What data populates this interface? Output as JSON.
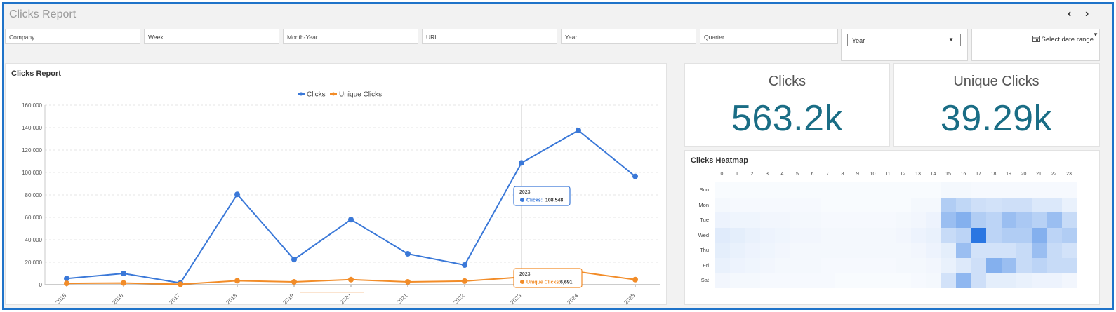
{
  "app": {
    "title": "Clicks Report",
    "prev_label": "‹",
    "next_label": "›"
  },
  "filters": {
    "company": "Company",
    "week": "Week",
    "month_year": "Month-Year",
    "url": "URL",
    "year": "Year",
    "quarter": "Quarter",
    "year_select": "Year",
    "date_range": "Select date range"
  },
  "chart_panel": {
    "title": "Clicks Report"
  },
  "kpis": {
    "clicks": {
      "label": "Clicks",
      "value": "563.2k"
    },
    "unique_clicks": {
      "label": "Unique Clicks",
      "value": "39.29k"
    }
  },
  "chart_data": {
    "type": "line",
    "title": "Clicks Report",
    "x": [
      "2015",
      "2016",
      "2017",
      "2018",
      "2019",
      "2020",
      "2021",
      "2022",
      "2023",
      "2024",
      "2025"
    ],
    "ylim": [
      0,
      160000
    ],
    "yticks": [
      0,
      20000,
      40000,
      60000,
      80000,
      100000,
      120000,
      140000,
      160000
    ],
    "ytick_labels": [
      "0",
      "20,000",
      "40,000",
      "60,000",
      "80,000",
      "100,000",
      "120,000",
      "140,000",
      "160,000"
    ],
    "legend": "top-center",
    "series": [
      {
        "name": "Clicks",
        "color": "#3a78d8",
        "values": [
          5500,
          10000,
          1500,
          80500,
          22500,
          58000,
          27500,
          17500,
          108548,
          137500,
          96500
        ]
      },
      {
        "name": "Unique Clicks",
        "color": "#f28c28",
        "values": [
          1200,
          1500,
          400,
          3500,
          2500,
          4500,
          2500,
          3200,
          6691,
          11500,
          4500
        ]
      }
    ],
    "tooltips": [
      {
        "x": "2023",
        "label": "Clicks:",
        "value": "108,548",
        "color": "#3a78d8"
      },
      {
        "x": "2023",
        "label": "Unique Clicks:",
        "value": "6,691",
        "color": "#f28c28"
      }
    ]
  },
  "heatmap": {
    "title": "Clicks Heatmap",
    "hours": [
      "0",
      "1",
      "2",
      "3",
      "4",
      "5",
      "6",
      "7",
      "8",
      "9",
      "10",
      "11",
      "12",
      "13",
      "14",
      "15",
      "16",
      "17",
      "18",
      "19",
      "20",
      "21",
      "22",
      "23"
    ],
    "days": [
      "Sun",
      "Mon",
      "Tue",
      "Wed",
      "Thu",
      "Fri",
      "Sat"
    ],
    "base_color": "#1f6fe0",
    "values": [
      [
        0.03,
        0.03,
        0.03,
        0.03,
        0.03,
        0.03,
        0.03,
        0.03,
        0.03,
        0.03,
        0.03,
        0.03,
        0.03,
        0.03,
        0.03,
        0.05,
        0.05,
        0.04,
        0.04,
        0.04,
        0.04,
        0.04,
        0.04,
        0.04
      ],
      [
        0.05,
        0.04,
        0.04,
        0.04,
        0.04,
        0.04,
        0.04,
        0.03,
        0.03,
        0.03,
        0.03,
        0.03,
        0.03,
        0.05,
        0.05,
        0.35,
        0.28,
        0.22,
        0.2,
        0.22,
        0.22,
        0.16,
        0.16,
        0.1
      ],
      [
        0.08,
        0.07,
        0.07,
        0.06,
        0.06,
        0.05,
        0.05,
        0.04,
        0.04,
        0.04,
        0.04,
        0.04,
        0.05,
        0.06,
        0.08,
        0.45,
        0.55,
        0.35,
        0.3,
        0.45,
        0.38,
        0.32,
        0.45,
        0.25
      ],
      [
        0.14,
        0.12,
        0.1,
        0.08,
        0.07,
        0.06,
        0.06,
        0.05,
        0.05,
        0.05,
        0.05,
        0.05,
        0.06,
        0.08,
        0.1,
        0.25,
        0.3,
        0.95,
        0.3,
        0.35,
        0.35,
        0.55,
        0.3,
        0.35
      ],
      [
        0.12,
        0.1,
        0.08,
        0.07,
        0.06,
        0.05,
        0.05,
        0.05,
        0.05,
        0.05,
        0.05,
        0.05,
        0.05,
        0.06,
        0.08,
        0.12,
        0.45,
        0.2,
        0.2,
        0.2,
        0.25,
        0.45,
        0.25,
        0.2
      ],
      [
        0.1,
        0.08,
        0.07,
        0.06,
        0.05,
        0.05,
        0.05,
        0.04,
        0.04,
        0.04,
        0.04,
        0.04,
        0.05,
        0.05,
        0.06,
        0.1,
        0.15,
        0.22,
        0.55,
        0.45,
        0.25,
        0.3,
        0.25,
        0.25
      ],
      [
        0.06,
        0.05,
        0.05,
        0.04,
        0.04,
        0.04,
        0.04,
        0.04,
        0.03,
        0.03,
        0.03,
        0.03,
        0.03,
        0.04,
        0.05,
        0.2,
        0.5,
        0.22,
        0.12,
        0.12,
        0.1,
        0.08,
        0.08,
        0.06
      ]
    ]
  }
}
